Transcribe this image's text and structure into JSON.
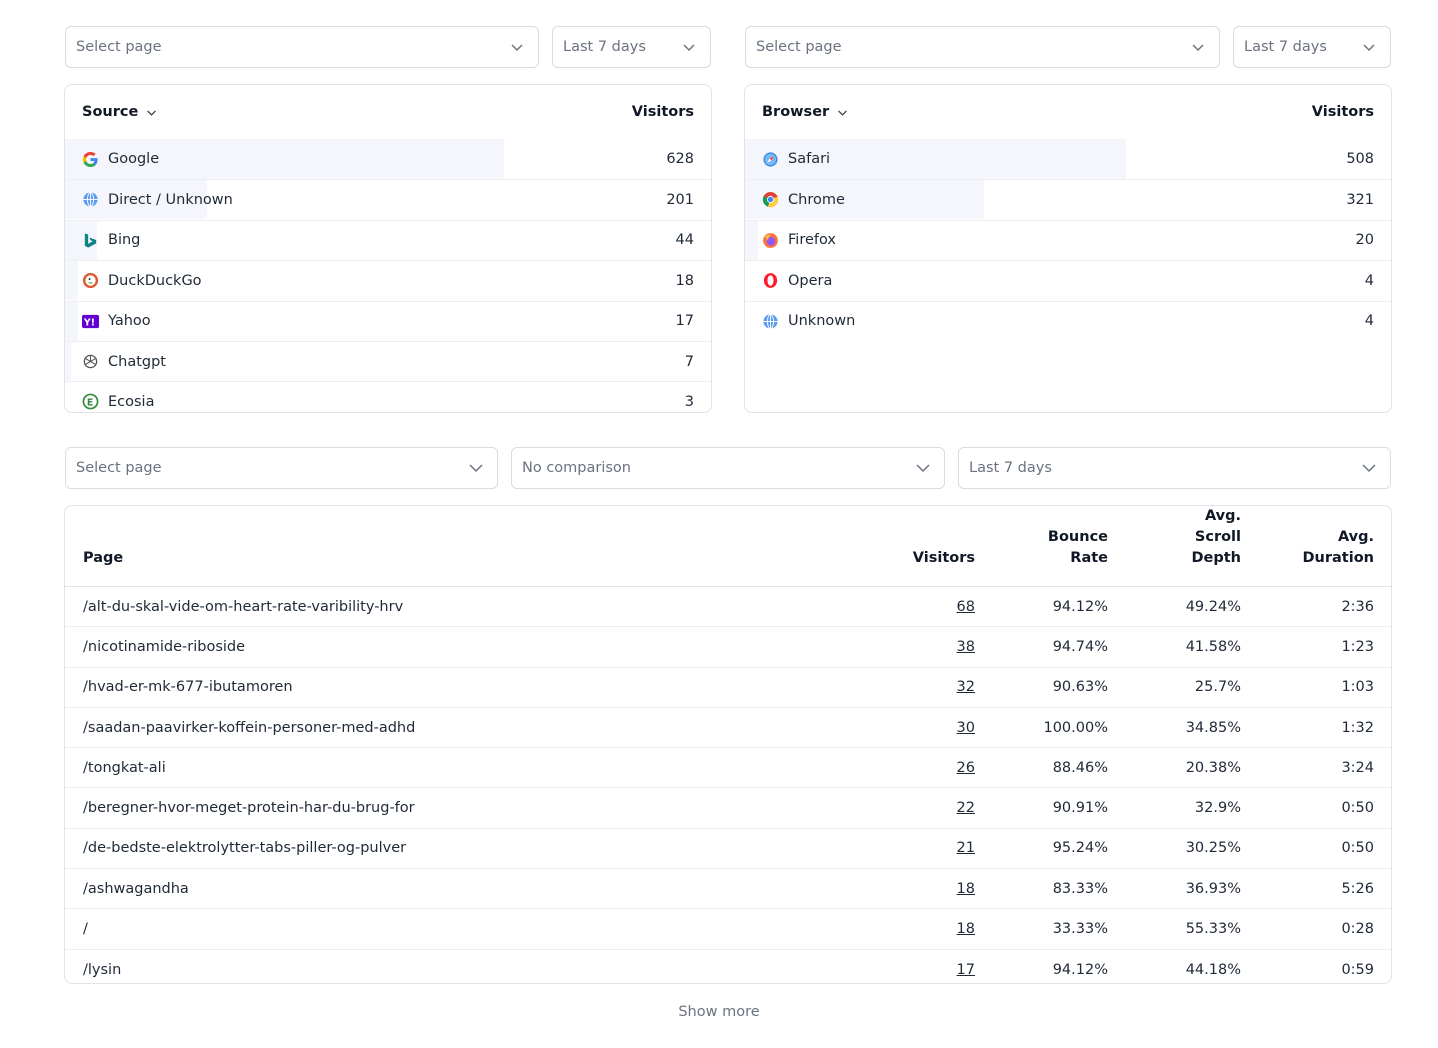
{
  "top_left": {
    "page_select": {
      "placeholder": "Select page"
    },
    "range_select": {
      "value": "Last 7 days"
    },
    "card": {
      "title": "Source",
      "column": "Visitors",
      "rows": [
        {
          "label": "Google",
          "value": "628",
          "icon": "google-icon",
          "share": 0.68
        },
        {
          "label": "Direct / Unknown",
          "value": "201",
          "icon": "globe-icon",
          "share": 0.22
        },
        {
          "label": "Bing",
          "value": "44",
          "icon": "bing-icon",
          "share": 0.05
        },
        {
          "label": "DuckDuckGo",
          "value": "18",
          "icon": "duckduckgo-icon",
          "share": 0.02
        },
        {
          "label": "Yahoo",
          "value": "17",
          "icon": "yahoo-icon",
          "share": 0.02
        },
        {
          "label": "Chatgpt",
          "value": "7",
          "icon": "chatgpt-icon",
          "share": 0.01
        },
        {
          "label": "Ecosia",
          "value": "3",
          "icon": "ecosia-icon",
          "share": 0.0
        }
      ]
    }
  },
  "top_right": {
    "page_select": {
      "placeholder": "Select page"
    },
    "range_select": {
      "value": "Last 7 days"
    },
    "card": {
      "title": "Browser",
      "column": "Visitors",
      "rows": [
        {
          "label": "Safari",
          "value": "508",
          "icon": "safari-icon",
          "share": 0.59
        },
        {
          "label": "Chrome",
          "value": "321",
          "icon": "chrome-icon",
          "share": 0.37
        },
        {
          "label": "Firefox",
          "value": "20",
          "icon": "firefox-icon",
          "share": 0.02
        },
        {
          "label": "Opera",
          "value": "4",
          "icon": "opera-icon",
          "share": 0.0
        },
        {
          "label": "Unknown",
          "value": "4",
          "icon": "globe-icon",
          "share": 0.0
        }
      ]
    }
  },
  "bottom": {
    "page_select": {
      "placeholder": "Select page"
    },
    "comparison_select": {
      "value": "No comparison"
    },
    "range_select": {
      "value": "Last 7 days"
    },
    "table": {
      "headers": {
        "page": "Page",
        "visitors": "Visitors",
        "bounce": "Bounce Rate",
        "scroll_1": "Avg.",
        "scroll_2": "Scroll Depth",
        "duration_1": "Avg.",
        "duration_2": "Duration"
      },
      "rows": [
        {
          "page": "/alt-du-skal-vide-om-heart-rate-varibility-hrv",
          "visitors": "68",
          "bounce": "94.12%",
          "scroll": "49.24%",
          "duration": "2:36"
        },
        {
          "page": "/nicotinamide-riboside",
          "visitors": "38",
          "bounce": "94.74%",
          "scroll": "41.58%",
          "duration": "1:23"
        },
        {
          "page": "/hvad-er-mk-677-ibutamoren",
          "visitors": "32",
          "bounce": "90.63%",
          "scroll": "25.7%",
          "duration": "1:03"
        },
        {
          "page": "/saadan-paavirker-koffein-personer-med-adhd",
          "visitors": "30",
          "bounce": "100.00%",
          "scroll": "34.85%",
          "duration": "1:32"
        },
        {
          "page": "/tongkat-ali",
          "visitors": "26",
          "bounce": "88.46%",
          "scroll": "20.38%",
          "duration": "3:24"
        },
        {
          "page": "/beregner-hvor-meget-protein-har-du-brug-for",
          "visitors": "22",
          "bounce": "90.91%",
          "scroll": "32.9%",
          "duration": "0:50"
        },
        {
          "page": "/de-bedste-elektrolytter-tabs-piller-og-pulver",
          "visitors": "21",
          "bounce": "95.24%",
          "scroll": "30.25%",
          "duration": "0:50"
        },
        {
          "page": "/ashwagandha",
          "visitors": "18",
          "bounce": "83.33%",
          "scroll": "36.93%",
          "duration": "5:26"
        },
        {
          "page": "/",
          "visitors": "18",
          "bounce": "33.33%",
          "scroll": "55.33%",
          "duration": "0:28"
        },
        {
          "page": "/lysin",
          "visitors": "17",
          "bounce": "94.12%",
          "scroll": "44.18%",
          "duration": "0:59"
        }
      ]
    },
    "show_more": "Show more"
  },
  "colors": {
    "border": "#dfe2e6",
    "bar": "#f4f6fb",
    "muted_text": "#6b7280",
    "strong_text": "#111827"
  }
}
